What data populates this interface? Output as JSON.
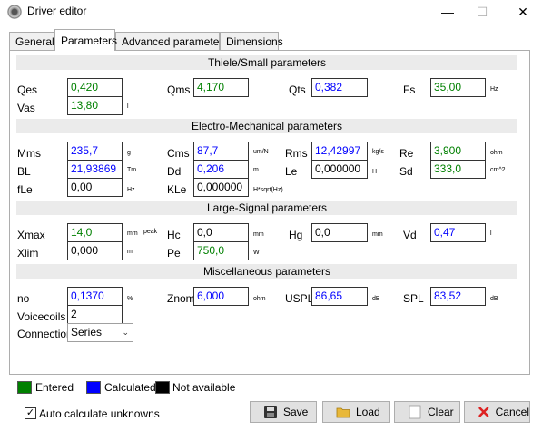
{
  "window": {
    "title": "Driver editor"
  },
  "tabs": [
    {
      "label": "General"
    },
    {
      "label": "Parameters"
    },
    {
      "label": "Advanced parameters"
    },
    {
      "label": "Dimensions"
    }
  ],
  "sections": {
    "ts": "Thiele/Small parameters",
    "em": "Electro-Mechanical parameters",
    "ls": "Large-Signal parameters",
    "misc": "Miscellaneous parameters"
  },
  "params": {
    "qes": {
      "label": "Qes",
      "value": "0,420"
    },
    "qms": {
      "label": "Qms",
      "value": "4,170"
    },
    "qts": {
      "label": "Qts",
      "value": "0,382"
    },
    "fs": {
      "label": "Fs",
      "value": "35,00",
      "unit": "Hz"
    },
    "vas": {
      "label": "Vas",
      "value": "13,80",
      "unit": "l"
    },
    "mms": {
      "label": "Mms",
      "value": "235,7",
      "unit": "g"
    },
    "cms": {
      "label": "Cms",
      "value": "87,7",
      "unit": "um/N"
    },
    "rms": {
      "label": "Rms",
      "value": "12,42997",
      "unit": "kg/s"
    },
    "re": {
      "label": "Re",
      "value": "3,900",
      "unit": "ohm"
    },
    "bl": {
      "label": "BL",
      "value": "21,93869",
      "unit": "Tm"
    },
    "dd": {
      "label": "Dd",
      "value": "0,206",
      "unit": "m"
    },
    "le": {
      "label": "Le",
      "value": "0,000000",
      "unit": "H"
    },
    "sd": {
      "label": "Sd",
      "value": "333,0",
      "unit": "cm^2"
    },
    "fle": {
      "label": "fLe",
      "value": "0,00",
      "unit": "Hz"
    },
    "kle": {
      "label": "KLe",
      "value": "0,000000",
      "unit": "H*sqrt(Hz)"
    },
    "xmax": {
      "label": "Xmax",
      "value": "14,0",
      "unit": "mm"
    },
    "peak": "peak",
    "hc": {
      "label": "Hc",
      "value": "0,0",
      "unit": "mm"
    },
    "hg": {
      "label": "Hg",
      "value": "0,0",
      "unit": "mm"
    },
    "vd": {
      "label": "Vd",
      "value": "0,47",
      "unit": "l"
    },
    "xlim": {
      "label": "Xlim",
      "value": "0,000",
      "unit": "m"
    },
    "pe": {
      "label": "Pe",
      "value": "750,0",
      "unit": "W"
    },
    "no": {
      "label": "no",
      "value": "0,1370",
      "unit": "%"
    },
    "znom": {
      "label": "Znom",
      "value": "6,000",
      "unit": "ohm"
    },
    "uspl": {
      "label": "USPL",
      "value": "86,65",
      "unit": "dB"
    },
    "spl": {
      "label": "SPL",
      "value": "83,52",
      "unit": "dB"
    },
    "voicecoils": {
      "label": "Voicecoils",
      "value": "2"
    },
    "connection": {
      "label": "Connection",
      "selected": "Series"
    }
  },
  "legend": {
    "entered": {
      "label": "Entered",
      "color": "#008000"
    },
    "calculated": {
      "label": "Calculated",
      "color": "#0000ff"
    },
    "na": {
      "label": "Not available",
      "color": "#000000"
    }
  },
  "auto_calc": {
    "label": "Auto calculate unknowns",
    "checked": true
  },
  "buttons": {
    "save": "Save",
    "load": "Load",
    "clear": "Clear",
    "cancel": "Cancel"
  },
  "colors": {
    "entered": "#008000",
    "calculated": "#0000ff",
    "na": "#000000"
  }
}
